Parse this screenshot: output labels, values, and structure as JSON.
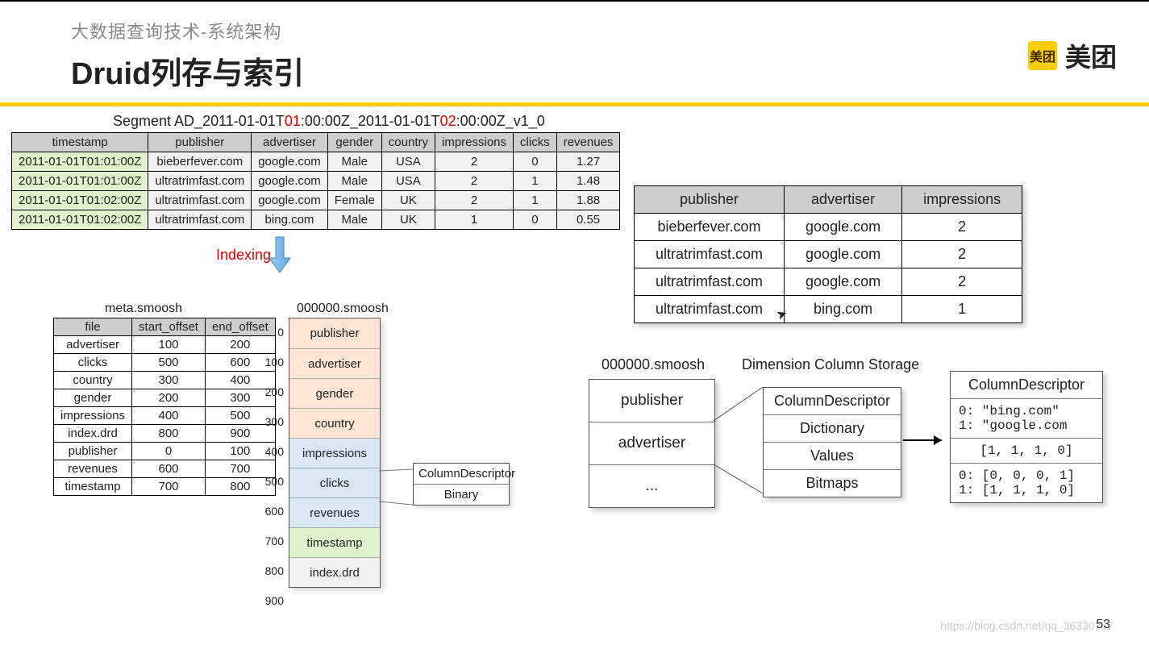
{
  "header": {
    "subtitle": "大数据查询技术-系统架构",
    "title": "Druid列存与索引"
  },
  "logo": {
    "badge": "美团",
    "text": "美团"
  },
  "segment_label": {
    "pre": "Segment AD_2011-01-01T",
    "r1": "01",
    "mid": ":00:00Z_2011-01-01T",
    "r2": "02",
    "post": ":00:00Z_v1_0"
  },
  "seg_headers": [
    "timestamp",
    "publisher",
    "advertiser",
    "gender",
    "country",
    "impressions",
    "clicks",
    "revenues"
  ],
  "seg_rows": [
    [
      "2011-01-01T01:01:00Z",
      "bieberfever.com",
      "google.com",
      "Male",
      "USA",
      "2",
      "0",
      "1.27"
    ],
    [
      "2011-01-01T01:01:00Z",
      "ultratrimfast.com",
      "google.com",
      "Male",
      "USA",
      "2",
      "1",
      "1.48"
    ],
    [
      "2011-01-01T01:02:00Z",
      "ultratrimfast.com",
      "google.com",
      "Female",
      "UK",
      "2",
      "1",
      "1.88"
    ],
    [
      "2011-01-01T01:02:00Z",
      "ultratrimfast.com",
      "bing.com",
      "Male",
      "UK",
      "1",
      "0",
      "0.55"
    ]
  ],
  "indexing": "Indexing",
  "meta": {
    "title": "meta.smoosh",
    "headers": [
      "file",
      "start_offset",
      "end_offset"
    ],
    "rows": [
      [
        "advertiser",
        "100",
        "200"
      ],
      [
        "clicks",
        "500",
        "600"
      ],
      [
        "country",
        "300",
        "400"
      ],
      [
        "gender",
        "200",
        "300"
      ],
      [
        "impressions",
        "400",
        "500"
      ],
      [
        "index.drd",
        "800",
        "900"
      ],
      [
        "publisher",
        "0",
        "100"
      ],
      [
        "revenues",
        "600",
        "700"
      ],
      [
        "timestamp",
        "700",
        "800"
      ]
    ]
  },
  "smoosh": {
    "title": "000000.smoosh",
    "ticks": [
      "0",
      "100",
      "200",
      "300",
      "400",
      "500",
      "600",
      "700",
      "800",
      "900"
    ],
    "blocks": [
      {
        "label": "publisher",
        "cls": "c-pink"
      },
      {
        "label": "advertiser",
        "cls": "c-pink"
      },
      {
        "label": "gender",
        "cls": "c-pink"
      },
      {
        "label": "country",
        "cls": "c-pink"
      },
      {
        "label": "impressions",
        "cls": "c-blue"
      },
      {
        "label": "clicks",
        "cls": "c-blue"
      },
      {
        "label": "revenues",
        "cls": "c-blue"
      },
      {
        "label": "timestamp",
        "cls": "c-green"
      },
      {
        "label": "index.drd",
        "cls": "c-lgrey"
      }
    ]
  },
  "binbox": [
    "ColumnDescriptor",
    "Binary"
  ],
  "sel": {
    "headers": [
      "publisher",
      "advertiser",
      "impressions"
    ],
    "rows": [
      [
        "bieberfever.com",
        "google.com",
        "2"
      ],
      [
        "ultratrimfast.com",
        "google.com",
        "2"
      ],
      [
        "ultratrimfast.com",
        "google.com",
        "2"
      ],
      [
        "ultratrimfast.com",
        "bing.com",
        "1"
      ]
    ]
  },
  "smoosh2": {
    "title": "000000.smoosh",
    "items": [
      "publisher",
      "advertiser",
      "..."
    ]
  },
  "dimlabel": "Dimension Column Storage",
  "desc": [
    "ColumnDescriptor",
    "Dictionary",
    "Values",
    "Bitmaps"
  ],
  "advertiser_detail": {
    "title": "ColumnDescriptor",
    "dict": "0: \"bing.com\"\n1: \"google.com",
    "values": "[1, 1, 1, 0]",
    "bitmaps": "0: [0, 0, 0, 1]\n1: [1, 1, 1, 0]"
  },
  "pagenum": "53",
  "watermark": "https://blog.csdn.net/qq_36330757"
}
